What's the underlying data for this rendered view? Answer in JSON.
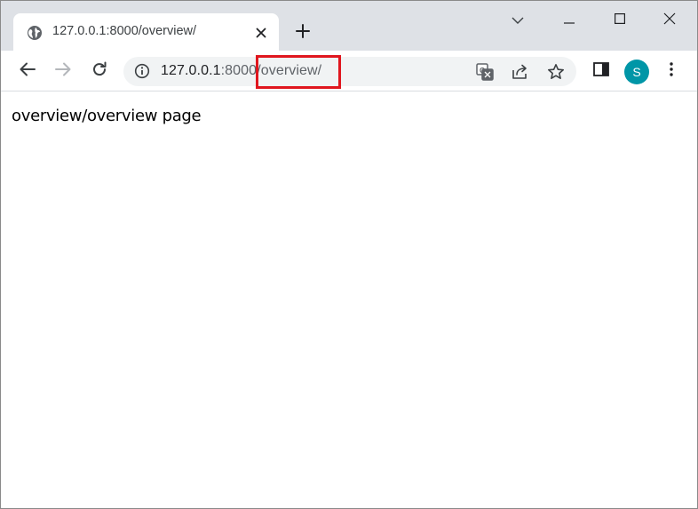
{
  "tab": {
    "title": "127.0.0.1:8000/overview/"
  },
  "address_bar": {
    "host": "127.0.0.1",
    "port": ":8000",
    "path": "/overview/"
  },
  "profile": {
    "initial": "S",
    "color": "#0096a7"
  },
  "highlight": {
    "color": "#e0161e"
  },
  "page": {
    "text": "overview/overview page"
  },
  "icons": {
    "favicon": "globe-icon",
    "tab_close": "close-icon",
    "new_tab": "plus-icon",
    "tab_search": "chevron-down-icon",
    "minimize": "minimize-icon",
    "maximize": "maximize-icon",
    "close_window": "close-icon",
    "back": "arrow-left-icon",
    "forward": "arrow-right-icon",
    "reload": "reload-icon",
    "site_info": "info-icon",
    "translate": "translate-icon",
    "share": "share-icon",
    "bookmark": "star-icon",
    "side_panel": "side-panel-icon",
    "menu": "kebab-menu-icon"
  }
}
